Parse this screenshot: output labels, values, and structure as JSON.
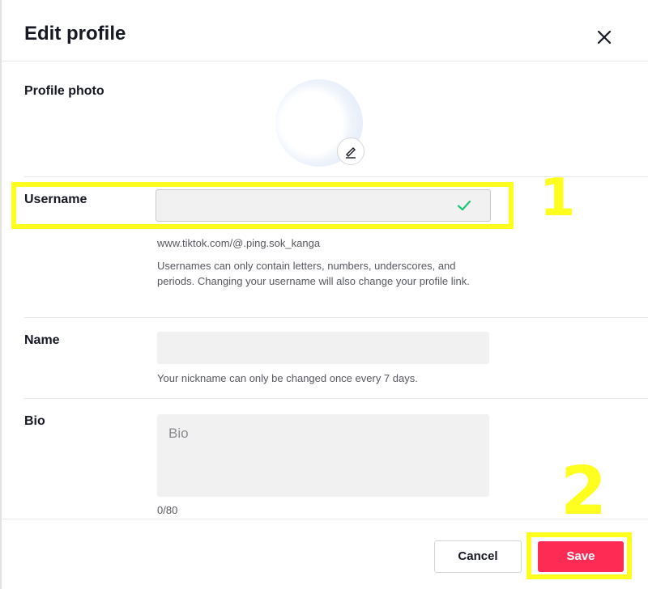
{
  "header": {
    "title": "Edit profile",
    "close_icon": "close-icon"
  },
  "profile_photo": {
    "label": "Profile photo",
    "edit_icon": "pencil-icon"
  },
  "username": {
    "label": "Username",
    "value": "",
    "status_icon": "checkmark-icon",
    "link": "www.tiktok.com/@.ping.sok_kanga",
    "help": "Usernames can only contain letters, numbers, underscores, and periods. Changing your username will also change your profile link."
  },
  "name": {
    "label": "Name",
    "value": "",
    "help": "Your nickname can only be changed once every 7 days."
  },
  "bio": {
    "label": "Bio",
    "placeholder": "Bio",
    "value": "",
    "counter": "0/80"
  },
  "footer": {
    "cancel_label": "Cancel",
    "save_label": "Save"
  },
  "annotations": {
    "step1": "1",
    "step2": "2"
  },
  "colors": {
    "accent": "#fe2c55",
    "highlight": "#ffff1f",
    "check": "#20c375"
  }
}
